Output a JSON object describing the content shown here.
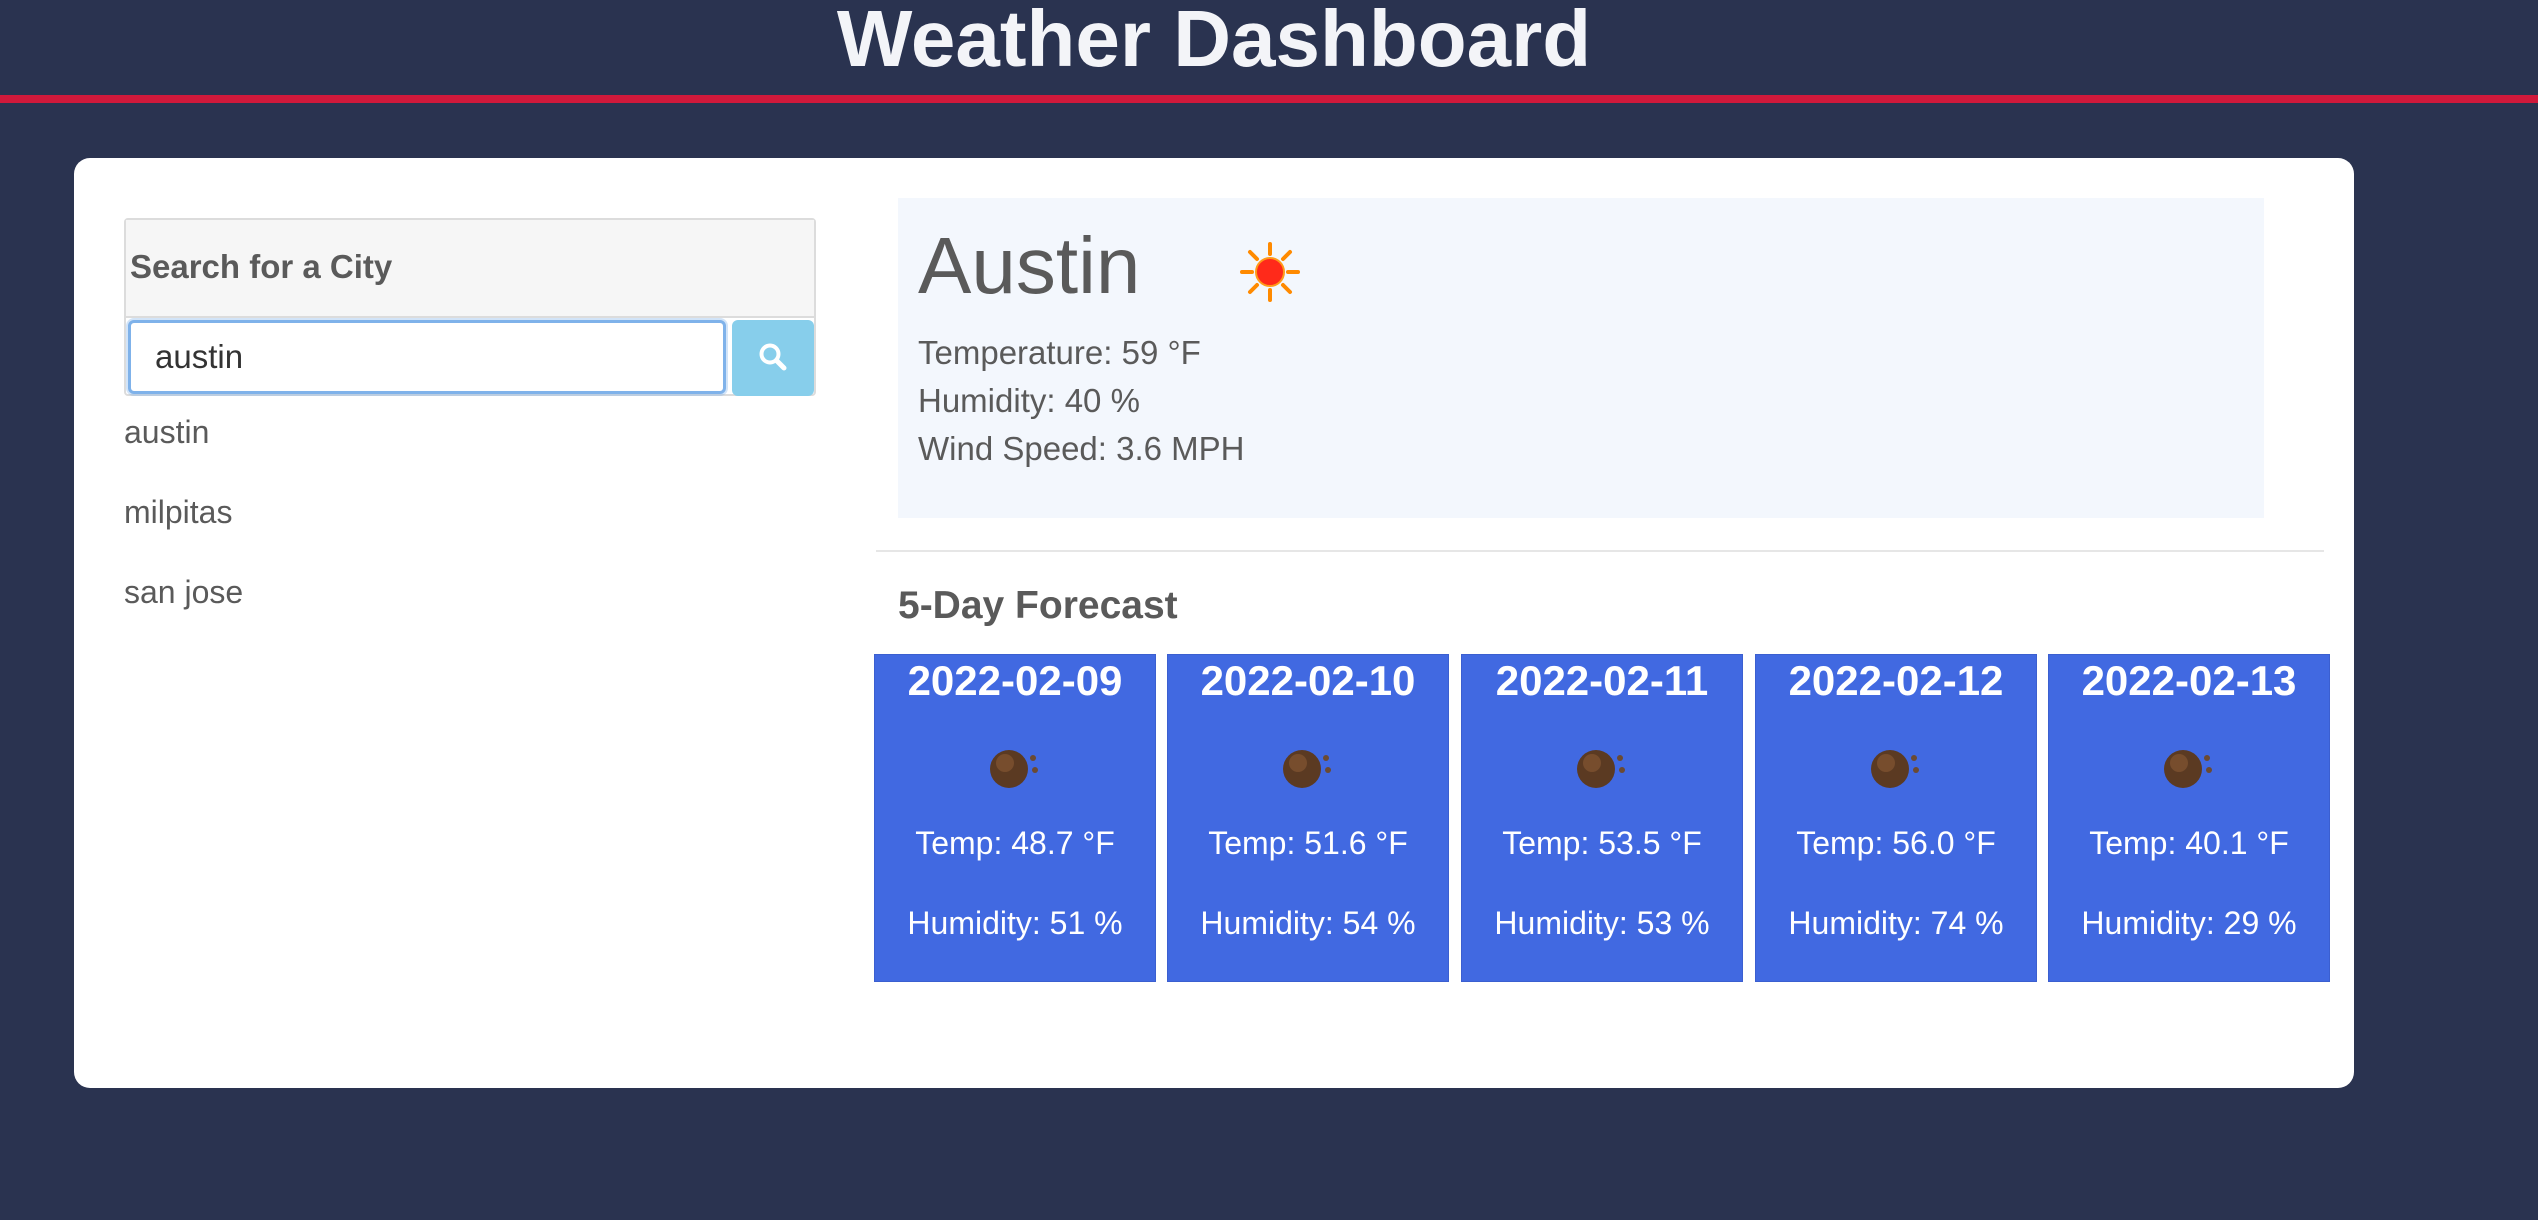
{
  "header": {
    "title": "Weather Dashboard"
  },
  "search": {
    "title": "Search for a City",
    "value": "austin",
    "button_icon": "search-icon"
  },
  "history": [
    "austin",
    "milpitas",
    "san jose"
  ],
  "current": {
    "city": "Austin",
    "icon": "sun-icon",
    "temperature": "Temperature: 59 °F",
    "humidity": "Humidity: 40 %",
    "wind": "Wind Speed: 3.6 MPH"
  },
  "forecast": {
    "title": "5-Day Forecast",
    "days": [
      {
        "date": "2022-02-09",
        "icon": "cloud-icon",
        "temp": "Temp: 48.7 °F",
        "humidity": "Humidity: 51 %"
      },
      {
        "date": "2022-02-10",
        "icon": "cloud-icon",
        "temp": "Temp: 51.6 °F",
        "humidity": "Humidity: 54 %"
      },
      {
        "date": "2022-02-11",
        "icon": "cloud-icon",
        "temp": "Temp: 53.5 °F",
        "humidity": "Humidity: 53 %"
      },
      {
        "date": "2022-02-12",
        "icon": "cloud-icon",
        "temp": "Temp: 56.0 °F",
        "humidity": "Humidity: 74 %"
      },
      {
        "date": "2022-02-13",
        "icon": "cloud-icon",
        "temp": "Temp: 40.1 °F",
        "humidity": "Humidity: 29 %"
      }
    ]
  },
  "colors": {
    "background": "#2a3350",
    "header_border": "#d0193b",
    "card": "#ffffff",
    "current_panel": "#f3f7fd",
    "forecast_card": "#4169e1",
    "search_button": "#87ceeb"
  }
}
